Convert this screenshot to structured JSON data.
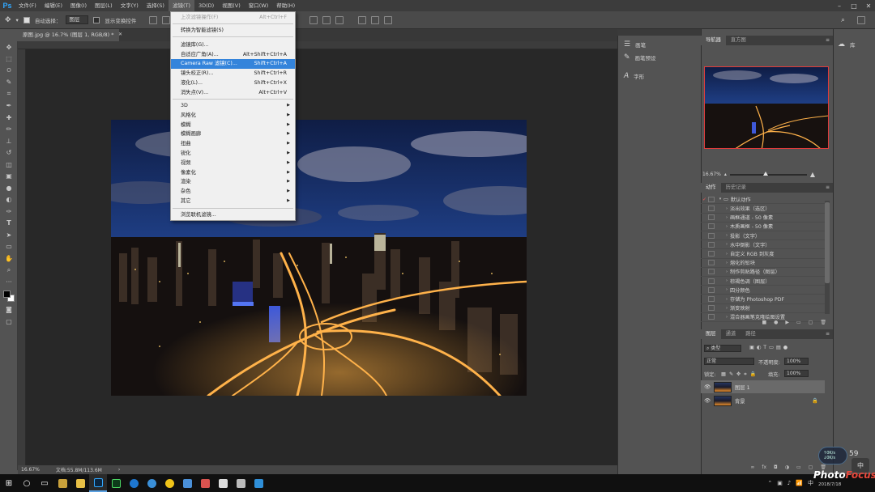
{
  "app": {
    "logo": "Ps",
    "menus": [
      "文件(F)",
      "编辑(E)",
      "图像(I)",
      "图层(L)",
      "文字(Y)",
      "选择(S)",
      "滤镜(T)",
      "3D(D)",
      "视图(V)",
      "窗口(W)",
      "帮助(H)"
    ],
    "active_menu": "滤镜(T)"
  },
  "options_bar": {
    "auto_select_label": "自动选择：",
    "auto_select_value": "图层",
    "show_transform_label": "显示变换控件"
  },
  "document": {
    "tab_label": "原图.jpg @ 16.7% (图层 1, RGB/8) *",
    "zoom": "16.67%",
    "doc_info": "文档:55.8M/113.6M"
  },
  "filter_menu": {
    "items": [
      {
        "label": "上次滤镜操作(F)",
        "shortcut": "Alt+Ctrl+F",
        "disabled": true
      },
      {
        "label": "转换为智能滤镜(S)",
        "shortcut": ""
      },
      {
        "label": "滤镜库(G)...",
        "shortcut": ""
      },
      {
        "label": "自适应广角(A)...",
        "shortcut": "Alt+Shift+Ctrl+A"
      },
      {
        "label": "Camera Raw 滤镜(C)...",
        "shortcut": "Shift+Ctrl+A",
        "selected": true
      },
      {
        "label": "镜头校正(R)...",
        "shortcut": "Shift+Ctrl+R"
      },
      {
        "label": "液化(L)...",
        "shortcut": "Shift+Ctrl+X"
      },
      {
        "label": "消失点(V)...",
        "shortcut": "Alt+Ctrl+V"
      },
      {
        "label": "3D",
        "submenu": true
      },
      {
        "label": "风格化",
        "submenu": true
      },
      {
        "label": "模糊",
        "submenu": true
      },
      {
        "label": "模糊画廊",
        "submenu": true
      },
      {
        "label": "扭曲",
        "submenu": true
      },
      {
        "label": "锐化",
        "submenu": true
      },
      {
        "label": "视频",
        "submenu": true
      },
      {
        "label": "像素化",
        "submenu": true
      },
      {
        "label": "渲染",
        "submenu": true
      },
      {
        "label": "杂色",
        "submenu": true
      },
      {
        "label": "其它",
        "submenu": true
      },
      {
        "label": "浏览联机滤镜...",
        "shortcut": ""
      }
    ]
  },
  "mid_panel": {
    "items": [
      "画笔",
      "画笔预设",
      "字形"
    ]
  },
  "navigator": {
    "tabs": [
      "导航器",
      "直方图"
    ],
    "zoom": "16.67%"
  },
  "actions": {
    "tabs": [
      "动作",
      "历史记录"
    ],
    "set_name": "默认动作",
    "items": [
      "淡出效果（选区）",
      "画框通道 - 50 像素",
      "木质画框 - 50 像素",
      "投影（文字）",
      "水中倒影（文字）",
      "自定义 RGB 到灰度",
      "熔化的铅块",
      "制作剪贴路径（图层）",
      "棕褐色调（图层）",
      "四分颜色",
      "存储为 Photoshop PDF",
      "渐变映射",
      "混合器画笔克隆绘图设置"
    ]
  },
  "layers": {
    "tabs": [
      "图层",
      "通道",
      "路径"
    ],
    "filter_kind": "类型",
    "blend_mode": "正常",
    "opacity_label": "不透明度:",
    "opacity": "100%",
    "lock_label": "锁定:",
    "fill_label": "填充:",
    "fill": "100%",
    "rows": [
      {
        "name": "图层 1",
        "selected": true
      },
      {
        "name": "背景",
        "selected": false
      }
    ]
  },
  "far_right": {
    "label": "库"
  },
  "watermark": {
    "text_white": "Photo",
    "text_red": "Focus"
  },
  "tray": {
    "date": "2018/7/18",
    "ime": "中",
    "speed_up": "0K/s",
    "speed_down": "0K/s",
    "cpu": "59"
  },
  "colors": {
    "accent": "#3484db",
    "ps_blue": "#31a8ff",
    "nav_frame": "#e03c3c"
  }
}
